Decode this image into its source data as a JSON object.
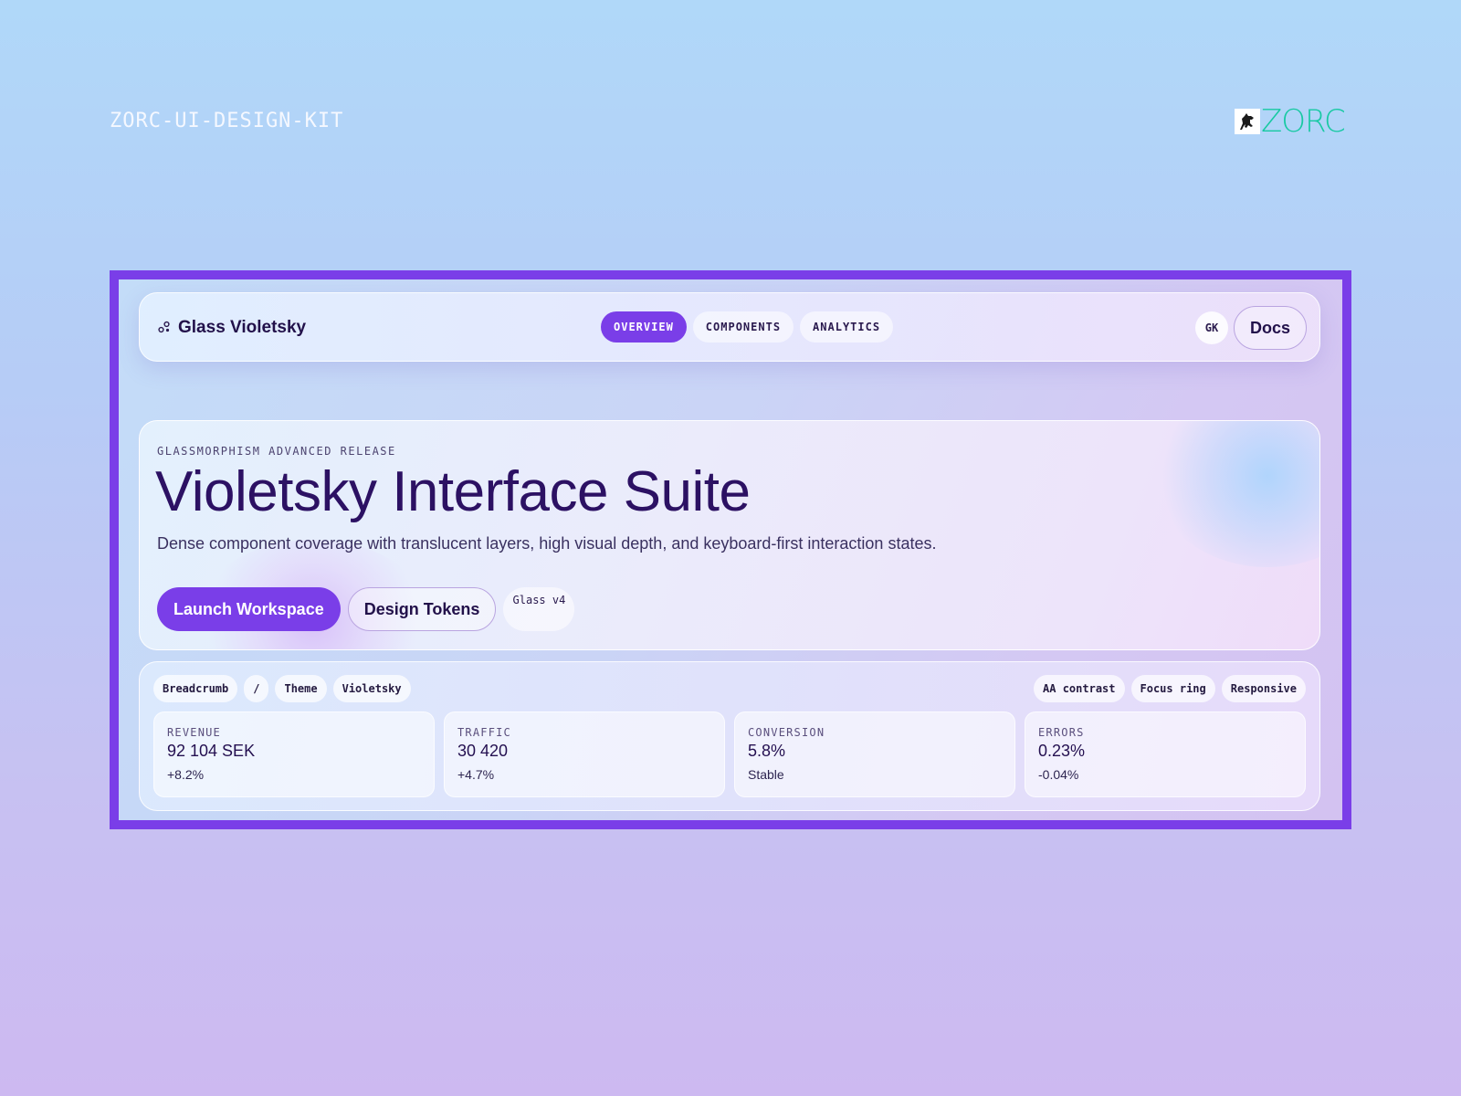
{
  "kit_label": "ZORC-UI-DESIGN-KIT",
  "brand_logo": {
    "text": "ZORC",
    "color": "#17c9a2",
    "icon": "dog-mascot-icon"
  },
  "accent_color": "#7a3ee8",
  "navbar": {
    "brand_icon": "molecule-icon",
    "brand_name": "Glass Violetsky",
    "tabs": [
      {
        "label": "OVERVIEW",
        "active": true
      },
      {
        "label": "COMPONENTS",
        "active": false
      },
      {
        "label": "ANALYTICS",
        "active": false
      }
    ],
    "avatar_initials": "GK",
    "docs_label": "Docs"
  },
  "hero": {
    "eyebrow": "GLASSMORPHISM ADVANCED RELEASE",
    "title": "Violetsky Interface Suite",
    "description": "Dense component coverage with translucent layers, high visual depth, and keyboard-first interaction states.",
    "primary_action": "Launch Workspace",
    "secondary_action": "Design Tokens",
    "version_chip": "Glass v4"
  },
  "stats": {
    "breadcrumb": [
      "Breadcrumb",
      "/",
      "Theme",
      "Violetsky"
    ],
    "flags": [
      "AA contrast",
      "Focus ring",
      "Responsive"
    ],
    "metrics": [
      {
        "label": "REVENUE",
        "value": "92 104 SEK",
        "delta": "+8.2%"
      },
      {
        "label": "TRAFFIC",
        "value": "30 420",
        "delta": "+4.7%"
      },
      {
        "label": "CONVERSION",
        "value": "5.8%",
        "delta": "Stable"
      },
      {
        "label": "ERRORS",
        "value": "0.23%",
        "delta": "-0.04%"
      }
    ]
  }
}
